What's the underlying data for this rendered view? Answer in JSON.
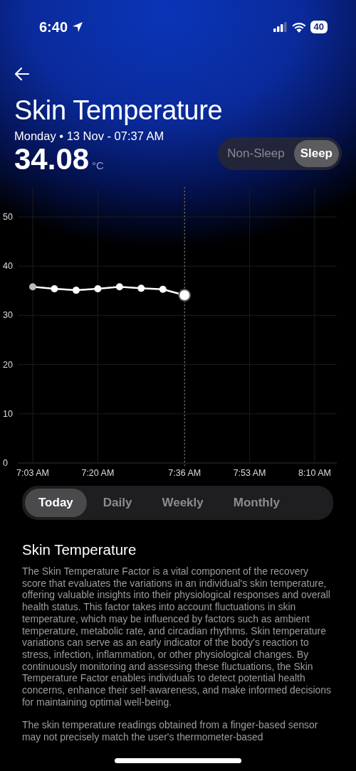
{
  "status_bar": {
    "time": "6:40",
    "battery": "40"
  },
  "header": {
    "title": "Skin Temperature",
    "date": "Monday • 13 Nov - 07:37 AM",
    "value": "34.08",
    "unit": "°C"
  },
  "mode_toggle": [
    {
      "label": "Non-Sleep",
      "selected": false
    },
    {
      "label": "Sleep",
      "selected": true
    }
  ],
  "chart": {
    "chart_data": {
      "type": "line",
      "categories": [
        "7:03 AM",
        null,
        null,
        "7:20 AM",
        null,
        null,
        null,
        "7:36 AM",
        null,
        null,
        "7:53 AM",
        null,
        null,
        "8:10 AM"
      ],
      "grid": true,
      "series": [
        {
          "color": "#ffffff",
          "marker": "circle",
          "values": [
            35.8,
            35.4,
            35.1,
            35.4,
            35.8,
            35.5,
            35.3,
            34.1,
            null,
            null,
            null,
            null,
            null,
            null
          ]
        }
      ],
      "ylim": [
        0,
        50
      ],
      "yticks": [
        0,
        10,
        20,
        30,
        40,
        50
      ]
    }
  },
  "period_tabs": [
    {
      "label": "Today",
      "selected": true
    },
    {
      "label": "Daily",
      "selected": false
    },
    {
      "label": "Weekly",
      "selected": false
    },
    {
      "label": "Monthly",
      "selected": false
    }
  ],
  "info": {
    "title": "Skin Temperature",
    "paragraphs": [
      "The Skin Temperature Factor is a vital component of the recovery score that evaluates the variations in an individual's skin temperature, offering valuable insights into their physiological responses and overall health status. This factor takes into account fluctuations in skin temperature, which may be influenced by factors such as ambient temperature, metabolic rate, and circadian rhythms. Skin temperature variations can serve as an early indicator of the body's reaction to stress, infection, inflammation, or other physiological changes. By continuously monitoring and assessing these fluctuations, the Skin Temperature Factor enables individuals to detect potential health concerns, enhance their self-awareness, and make informed decisions for maintaining optimal well-being.",
      "The skin temperature readings obtained from a finger-based sensor may not precisely match the user's thermometer-based"
    ]
  }
}
